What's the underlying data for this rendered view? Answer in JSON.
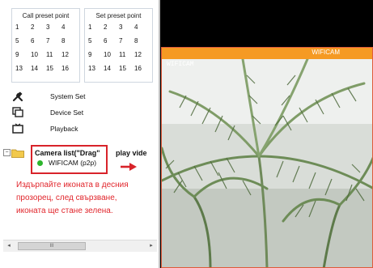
{
  "presets": {
    "call": {
      "title": "Call preset point",
      "numbers": [
        "1",
        "2",
        "3",
        "4",
        "5",
        "6",
        "7",
        "8",
        "9",
        "10",
        "11",
        "12",
        "13",
        "14",
        "15",
        "16"
      ]
    },
    "set": {
      "title": "Set preset point",
      "numbers": [
        "1",
        "2",
        "3",
        "4",
        "5",
        "6",
        "7",
        "8",
        "9",
        "10",
        "11",
        "12",
        "13",
        "14",
        "15",
        "16"
      ]
    }
  },
  "menu": {
    "system_set": "System Set",
    "device_set": "Device Set",
    "playback": "Playback"
  },
  "tree": {
    "header": "Camera list(\"Drag\"",
    "header_rest": "play vide",
    "expander": "−",
    "camera_label": "WIFICAM (p2p)",
    "camera_status_color": "#2db52d"
  },
  "instruction": "Издърпайте иконата в десния прозорец, след свързване, иконата ще стане зелена.",
  "scrollbar": {
    "left_arrow": "◂",
    "right_arrow": "▸",
    "thumb_grip": "III"
  },
  "video": {
    "title": "WIFICAM",
    "osd": "WIFICAM",
    "titlebar_color": "#f59a23"
  }
}
